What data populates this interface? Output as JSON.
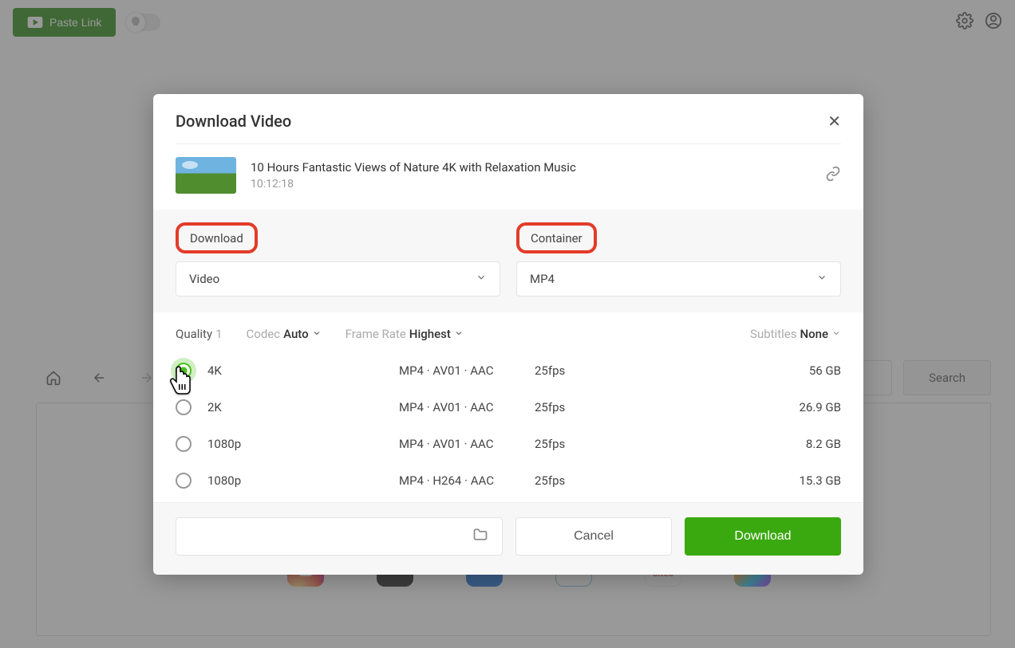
{
  "topbar": {
    "paste_label": "Paste Link"
  },
  "nav": {
    "search_label": "Search"
  },
  "modal": {
    "title": "Download Video",
    "video_title": "10 Hours Fantastic Views of Nature 4K with Relaxation Music",
    "video_duration": "10:12:18",
    "download_label": "Download",
    "container_label": "Container",
    "download_value": "Video",
    "container_value": "MP4",
    "quality_label": "Quality",
    "quality_badge": "1",
    "codec_label": "Codec",
    "codec_value": "Auto",
    "fps_label": "Frame Rate",
    "fps_value": "Highest",
    "subs_label": "Subtitles",
    "subs_value": "None",
    "rows": [
      {
        "res": "4K",
        "fmt": "MP4 · AV01 · AAC",
        "fps": "25fps",
        "size": "56 GB"
      },
      {
        "res": "2K",
        "fmt": "MP4 · AV01 · AAC",
        "fps": "25fps",
        "size": "26.9 GB"
      },
      {
        "res": "1080p",
        "fmt": "MP4 · AV01 · AAC",
        "fps": "25fps",
        "size": "8.2 GB"
      },
      {
        "res": "1080p",
        "fmt": "MP4 · H264 · AAC",
        "fps": "25fps",
        "size": "15.3 GB"
      }
    ],
    "cancel_label": "Cancel",
    "go_label": "Download"
  },
  "site_icons": {
    "bili": "bilibili",
    "adult": "adult sites",
    "d": "d"
  }
}
